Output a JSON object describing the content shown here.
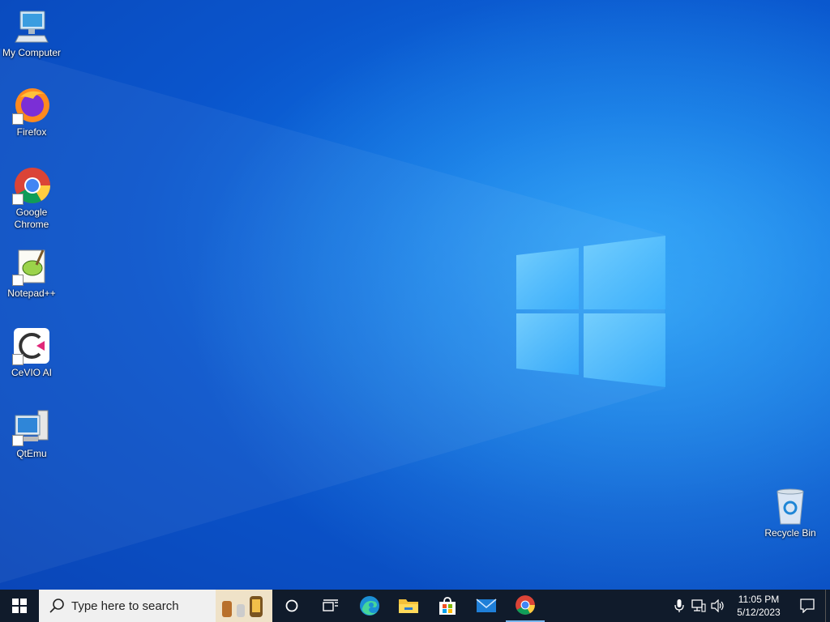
{
  "desktop": {
    "icons": [
      {
        "label": "My Computer",
        "icon": "computer-icon"
      },
      {
        "label": "Firefox",
        "icon": "firefox-icon"
      },
      {
        "label": "Google Chrome",
        "icon": "chrome-icon"
      },
      {
        "label": "Notepad++",
        "icon": "notepadpp-icon"
      },
      {
        "label": "CeVIO AI",
        "icon": "cevio-icon"
      },
      {
        "label": "QtEmu",
        "icon": "qtemu-icon"
      },
      {
        "label": "Recycle Bin",
        "icon": "recycle-bin-icon"
      }
    ]
  },
  "taskbar": {
    "search_placeholder": "Type here to search",
    "pinned": [
      "start-icon",
      "search-icon",
      "cortana-icon",
      "task-view-icon",
      "edge-icon",
      "file-explorer-icon",
      "store-icon",
      "mail-icon",
      "chrome-icon"
    ],
    "clock": {
      "time": "11:05 PM",
      "date": "5/12/2023"
    },
    "tray": [
      "microphone-icon",
      "network-icon",
      "volume-icon",
      "notification-icon"
    ]
  },
  "colors": {
    "wallpaper": "#0a55cc",
    "taskbar": "#101b2b",
    "search_box": "#f0f0f0"
  }
}
